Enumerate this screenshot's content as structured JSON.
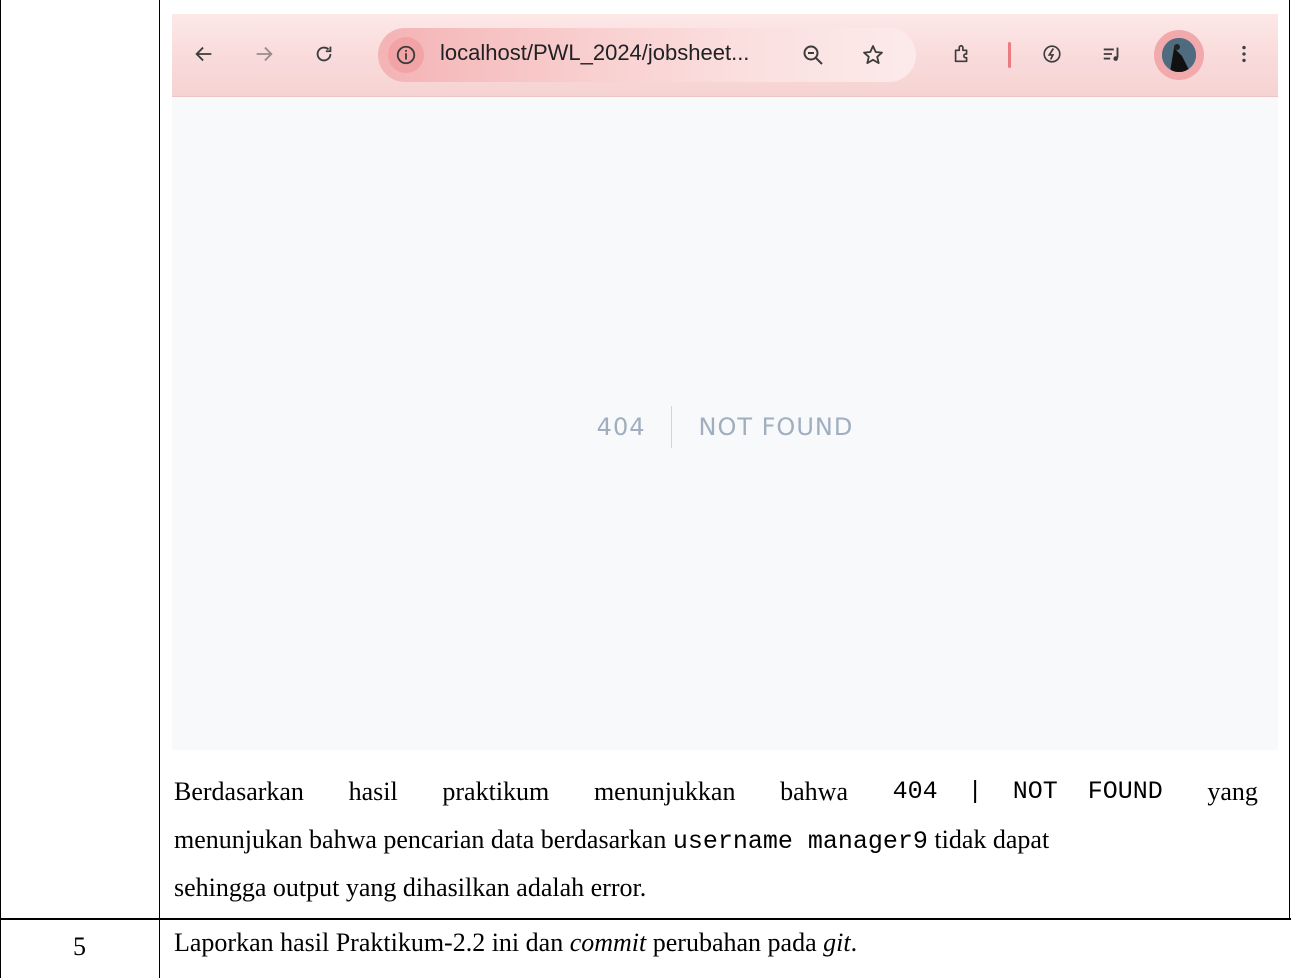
{
  "browser": {
    "url": "localhost/PWL_2024/jobsheet...",
    "accent": "#f2a3a6",
    "icons": [
      "back-arrow-icon",
      "forward-arrow-icon",
      "reload-icon",
      "info-icon",
      "zoom-icon",
      "star-icon",
      "extensions-icon",
      "leaf-icon",
      "media-icon",
      "avatar",
      "menu-icon"
    ]
  },
  "error_page": {
    "code": "404",
    "message": "NOT FOUND",
    "text_color": "#a0aec0"
  },
  "paragraph": {
    "l1_a": "Berdasarkan",
    "l1_b": "hasil",
    "l1_c": "praktikum",
    "l1_d": "menunjukkan",
    "l1_e": "bahwa",
    "l1_code": "404  |  NOT  FOUND",
    "l1_f": "yang",
    "l2_pre": "menunjukan bahwa pencarian data berdasarkan ",
    "l2_code": "username manager9",
    "l2_post": " tidak dapat",
    "l3": "sehingga output yang dihasilkan adalah error."
  },
  "row5": {
    "number": "5",
    "text_pre": "Laporkan hasil Praktikum-2.2 ini dan ",
    "text_em1": "commit",
    "text_mid": " perubahan pada ",
    "text_em2": "git",
    "text_end": "."
  }
}
